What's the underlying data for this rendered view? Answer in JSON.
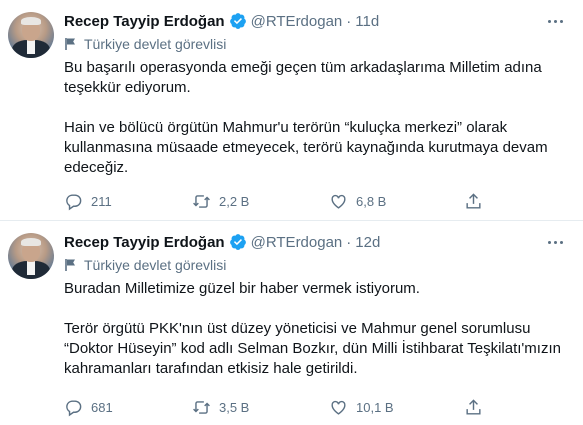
{
  "tweets": [
    {
      "name": "Recep Tayyip Erdoğan",
      "handle": "@RTErdogan",
      "dot": "·",
      "time": "11d",
      "label": "Türkiye devlet görevlisi",
      "paragraphs": [
        "Bu başarılı operasyonda emeği geçen tüm arkadaşlarıma Milletim adına teşekkür ediyorum.",
        "Hain ve bölücü örgütün Mahmur'u terörün “kuluçka merkezi” olarak kullanmasına müsaade etmeyecek, terörü kaynağında kurutmaya devam edeceğiz."
      ],
      "replies": "211",
      "retweets": "2,2 B",
      "likes": "6,8 B"
    },
    {
      "name": "Recep Tayyip Erdoğan",
      "handle": "@RTErdogan",
      "dot": "·",
      "time": "12d",
      "label": "Türkiye devlet görevlisi",
      "paragraphs": [
        "Buradan Milletimize güzel bir haber vermek istiyorum.",
        "Terör örgütü PKK'nın üst düzey yöneticisi ve Mahmur genel sorumlusu “Doktor Hüseyin” kod adlı Selman Bozkır, dün Milli İstihbarat Teşkilatı'mızın kahramanları tarafından etkisiz hale getirildi."
      ],
      "replies": "681",
      "retweets": "3,5 B",
      "likes": "10,1 B"
    }
  ],
  "icons": {
    "verified": "verified-badge-icon",
    "label": "flag-icon",
    "more": "more-icon",
    "reply": "reply-icon",
    "retweet": "retweet-icon",
    "like": "heart-icon",
    "share": "share-icon"
  },
  "colors": {
    "verified": "#1da1f2",
    "secondary_text": "#5b7083",
    "primary_text": "#0f1419",
    "divider": "#e6ecf0"
  }
}
